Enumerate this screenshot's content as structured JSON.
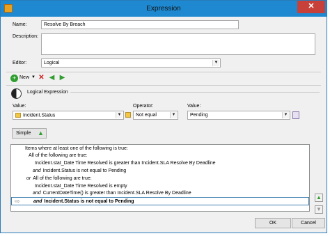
{
  "window": {
    "title": "Expression",
    "close_glyph": "✕"
  },
  "form": {
    "name_label": "Name:",
    "name_value": "Resolve By Breach",
    "description_label": "Description:",
    "description_value": "",
    "editor_label": "Editor:",
    "editor_value": "Logical"
  },
  "toolbar": {
    "new_label": "New",
    "new_icon": "green-circle-plus-icon",
    "delete_icon": "red-x-icon",
    "back_icon": "green-left-arrow-icon",
    "forward_icon": "green-right-arrow-icon"
  },
  "section": {
    "title": "Logical Expression",
    "icon": "yin-yang-icon"
  },
  "condition": {
    "value_label": "Value:",
    "value_field": "Incident.Status",
    "operator_label": "Operator:",
    "operator_value": "Not equal",
    "right_value_label": "Value:",
    "right_value": "Pending"
  },
  "mode": {
    "button_label": "Simple"
  },
  "tree": {
    "lines": [
      {
        "conj": "",
        "text": "Items where at least one of the following is true:",
        "bold": false
      },
      {
        "conj": "",
        "text": "All of the following are true:",
        "bold": false
      },
      {
        "conj": "",
        "text": "Incident.stat_Date Time Resolved is greater than Incident.SLA Resolve By Deadline",
        "bold": false
      },
      {
        "conj": "and",
        "text": "Incident.Status is not equal to Pending",
        "bold": false
      },
      {
        "conj": "or",
        "text": "All of the following are true:",
        "bold": false
      },
      {
        "conj": "",
        "text": "Incident.stat_Date Time Resolved is empty",
        "bold": false
      },
      {
        "conj": "and",
        "text": "CurrentDateTime() is greater than Incident.SLA Resolve By Deadline",
        "bold": false
      },
      {
        "conj": "and",
        "text": "Incident.Status is not equal to Pending",
        "bold": true
      }
    ]
  },
  "footer": {
    "ok_label": "OK",
    "cancel_label": "Cancel"
  },
  "colors": {
    "titlebar": "#1e89d1",
    "close": "#c7413a",
    "selection_border": "#3c7fb1"
  }
}
